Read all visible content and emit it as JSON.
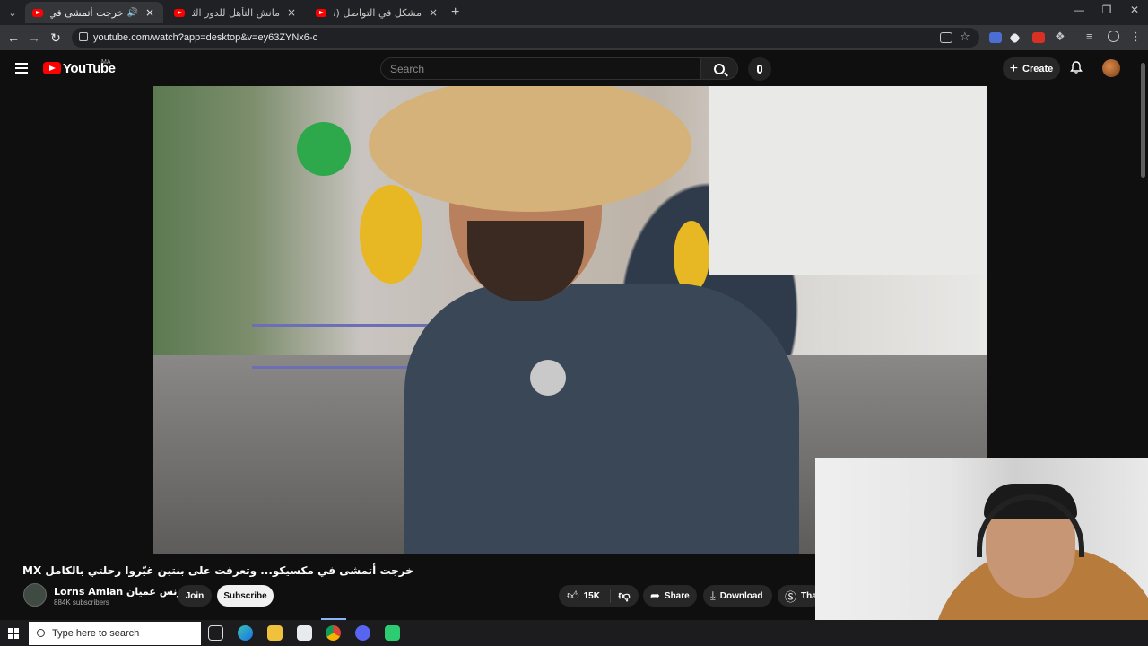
{
  "browser": {
    "tabs": [
      {
        "title": "خرجت أتمشى في مكسيكو...",
        "active": true,
        "audio": true
      },
      {
        "title": "مانش التأهل للدور الثاني؟ التشك...",
        "active": false
      },
      {
        "title": "مشكل في التواصل (نظرية البرزاك...",
        "active": false
      }
    ],
    "url": "youtube.com/watch?app=desktop&v=ey63ZYNx6-c"
  },
  "youtube": {
    "logo_text": "YouTube",
    "region": "MA",
    "search_placeholder": "Search",
    "create_label": "Create"
  },
  "video": {
    "title": "خرجت أتمشى في مكسيكو... وتعرفت على بنتين غيّروا رحلتي بالكامل MX",
    "channel_name": "Lorns Amian لورنس عميان",
    "verified": true,
    "subscribers": "884K subscribers",
    "join_label": "Join",
    "subscribe_label": "Subscribe",
    "likes": "15K",
    "share_label": "Share",
    "download_label": "Download",
    "thanks_label": "Tha"
  },
  "taskbar": {
    "search_placeholder": "Type here to search"
  },
  "colors": {
    "yt_red": "#ff0000",
    "bg": "#0f0f0f",
    "chrome_dark": "#202124",
    "chrome_toolbar": "#35363a"
  }
}
